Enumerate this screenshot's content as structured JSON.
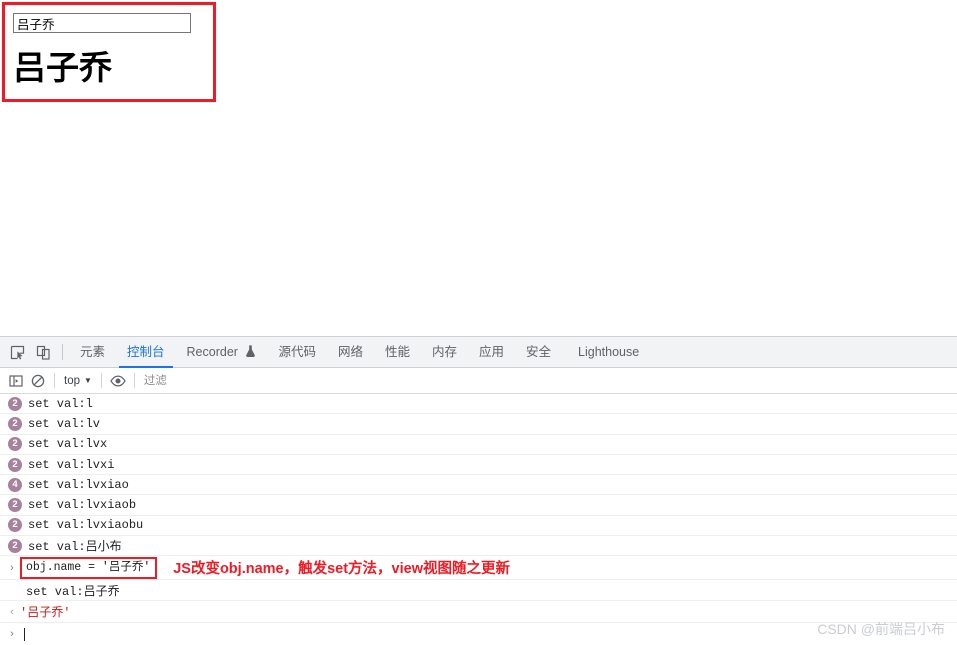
{
  "page": {
    "input_value": "吕子乔",
    "input_placeholder": "",
    "display_text": "吕子乔"
  },
  "devtools": {
    "tab_bar": {
      "inspect_icon": "inspect-element-icon",
      "device_icon": "device-toolbar-icon",
      "tabs": [
        {
          "label": "元素",
          "active": false
        },
        {
          "label": "控制台",
          "active": true
        },
        {
          "label": "Recorder",
          "active": false,
          "badge": "flask-icon"
        },
        {
          "label": "源代码",
          "active": false
        },
        {
          "label": "网络",
          "active": false
        },
        {
          "label": "性能",
          "active": false
        },
        {
          "label": "内存",
          "active": false
        },
        {
          "label": "应用",
          "active": false
        },
        {
          "label": "安全",
          "active": false
        },
        {
          "label": "Lighthouse",
          "active": false
        }
      ]
    },
    "filter_bar": {
      "sidebar_icon": "console-sidebar-icon",
      "clear_icon": "clear-console-icon",
      "context": "top",
      "context_caret": "▼",
      "eye_icon": "live-expression-eye-icon",
      "filter_placeholder": "过滤",
      "filter_value": ""
    },
    "console_rows": [
      {
        "count": "2",
        "text": "set val:l"
      },
      {
        "count": "2",
        "text": "set val:lv"
      },
      {
        "count": "2",
        "text": "set val:lvx"
      },
      {
        "count": "2",
        "text": "set val:lvxi"
      },
      {
        "count": "4",
        "text": "set val:lvxiao"
      },
      {
        "count": "2",
        "text": "set val:lvxiaob"
      },
      {
        "count": "2",
        "text": "set val:lvxiaobu"
      },
      {
        "count": "2",
        "text": "set val:吕小布"
      }
    ],
    "command": {
      "input_chevron": "›",
      "text": "obj.name = '吕子乔'",
      "annotation": "JS改变obj.name，触发set方法，view视图随之更新",
      "echo": "set val:吕子乔",
      "result_chevron": "‹",
      "result": "'吕子乔'",
      "prompt_chevron": "›"
    }
  },
  "watermark": "CSDN @前端吕小布",
  "colors": {
    "accent_red": "#ee1b24",
    "tab_active": "#1a73e8",
    "count_badge": "#a6829c",
    "string_red": "#c41a16"
  }
}
